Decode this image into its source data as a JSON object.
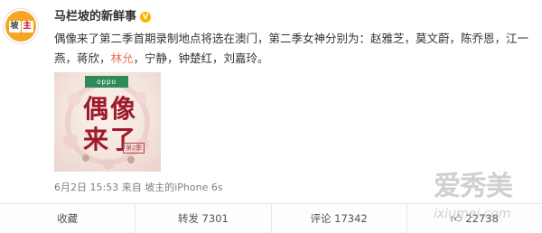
{
  "author": {
    "name": "马栏坡的新鲜事",
    "avatar_chars": [
      "坡",
      "主"
    ],
    "verified": true
  },
  "post": {
    "text_before": "偶像来了第二季首期录制地点将选在澳门，第二季女神分别为：赵雅芝，莫文蔚，陈乔恩，江一燕，蒋欣，",
    "text_link": "林允",
    "text_after": "，宁静，钟楚红，刘嘉玲。"
  },
  "image": {
    "brand_label": "oppo",
    "title_line1": "偶像",
    "title_line2": "来了",
    "badge": "第2季"
  },
  "meta": {
    "timestamp": "6月2日 15:53",
    "source_prefix": " 来自 ",
    "source": "坡主的iPhone 6s"
  },
  "actions": {
    "favorite": "收藏",
    "repost": "转发 7301",
    "comment": "评论 17342",
    "like_count": "22738"
  },
  "watermark": {
    "title": "爱秀美",
    "url": "ixiumei.com"
  },
  "colors": {
    "link": "#eb7350",
    "avatar_bg": "#f6a623",
    "verified": "#f7b500"
  }
}
